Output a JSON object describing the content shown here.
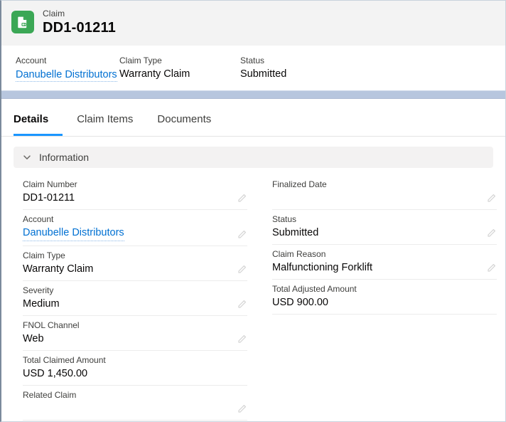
{
  "header": {
    "icon": "claim-document-icon",
    "icon_color": "#3ba755",
    "eyebrow": "Claim",
    "title": "DD1-01211"
  },
  "highlights": [
    {
      "label": "Account",
      "value": "Danubelle Distributors",
      "is_link": true
    },
    {
      "label": "Claim Type",
      "value": "Warranty Claim",
      "is_link": false
    },
    {
      "label": "Status",
      "value": "Submitted",
      "is_link": false
    }
  ],
  "tabs": [
    {
      "label": "Details",
      "active": true
    },
    {
      "label": "Claim Items",
      "active": false
    },
    {
      "label": "Documents",
      "active": false
    }
  ],
  "section": {
    "title": "Information",
    "expanded": true,
    "chevron_icon": "chevron-down-icon"
  },
  "fields": {
    "left": [
      {
        "label": "Claim Number",
        "value": "DD1-01211",
        "is_link": false,
        "editable": true
      },
      {
        "label": "Account",
        "value": "Danubelle Distributors",
        "is_link": true,
        "editable": true
      },
      {
        "label": "Claim Type",
        "value": "Warranty Claim",
        "is_link": false,
        "editable": true
      },
      {
        "label": "Severity",
        "value": "Medium",
        "is_link": false,
        "editable": true
      },
      {
        "label": "FNOL Channel",
        "value": "Web",
        "is_link": false,
        "editable": true
      },
      {
        "label": "Total Claimed Amount",
        "value": "USD 1,450.00",
        "is_link": false,
        "editable": false
      },
      {
        "label": "Related Claim",
        "value": "",
        "is_link": false,
        "editable": true
      }
    ],
    "right": [
      {
        "label": "Finalized Date",
        "value": "",
        "is_link": false,
        "editable": true
      },
      {
        "label": "Status",
        "value": "Submitted",
        "is_link": false,
        "editable": true
      },
      {
        "label": "Claim Reason",
        "value": "Malfunctioning Forklift",
        "is_link": false,
        "editable": true
      },
      {
        "label": "Total Adjusted Amount",
        "value": "USD 900.00",
        "is_link": false,
        "editable": false
      }
    ]
  },
  "colors": {
    "brand_blue": "#0070d2",
    "active_tab_underline": "#1b96ff",
    "icon_green": "#3ba755",
    "band_blue": "#b7c6de",
    "header_gray": "#f3f3f3"
  }
}
